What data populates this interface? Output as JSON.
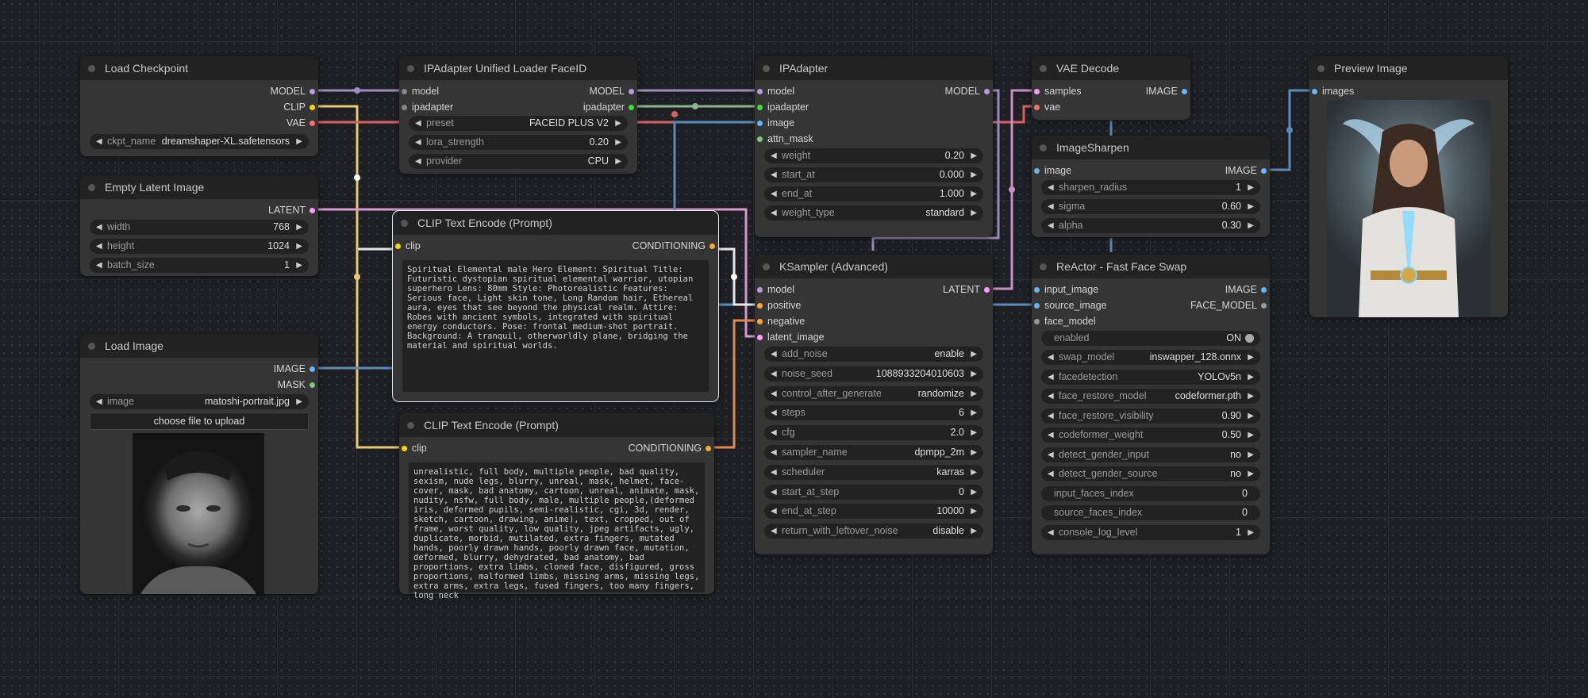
{
  "nodes": {
    "load_checkpoint": {
      "title": "Load Checkpoint",
      "out": [
        "MODEL",
        "CLIP",
        "VAE"
      ],
      "ckpt_label": "ckpt_name",
      "ckpt_value": "dreamshaper-XL.safetensors"
    },
    "empty_latent": {
      "title": "Empty Latent Image",
      "out": "LATENT",
      "width_label": "width",
      "width": "768",
      "height_label": "height",
      "height": "1024",
      "batch_label": "batch_size",
      "batch": "1"
    },
    "load_image": {
      "title": "Load Image",
      "out": [
        "IMAGE",
        "MASK"
      ],
      "image_label": "image",
      "image_value": "matoshi-portrait.jpg",
      "upload": "choose file to upload"
    },
    "ipa_loader": {
      "title": "IPAdapter Unified Loader FaceID",
      "in": [
        "model",
        "ipadapter"
      ],
      "out": [
        "MODEL",
        "ipadapter"
      ],
      "preset_label": "preset",
      "preset": "FACEID PLUS V2",
      "lora_label": "lora_strength",
      "lora": "0.20",
      "provider_label": "provider",
      "provider": "CPU"
    },
    "clip_pos": {
      "title": "CLIP Text Encode (Prompt)",
      "in": "clip",
      "out": "CONDITIONING",
      "text": "Spiritual Elemental male Hero Element: Spiritual Title: Futuristic dystopian spiritual elemental warrior, utopian superhero Lens: 80mm Style: Photorealistic Features: Serious face, Light skin tone, Long Random hair, Ethereal aura, eyes that see beyond the physical realm. Attire: Robes with ancient symbols, integrated with spiritual energy conductors. Pose: frontal medium-shot portrait. Background: A tranquil, otherworldly plane, bridging the material and spiritual worlds."
    },
    "clip_neg": {
      "title": "CLIP Text Encode (Prompt)",
      "in": "clip",
      "out": "CONDITIONING",
      "text": "unrealistic, full body, multiple people, bad quality, sexism, nude legs, blurry, unreal, mask, helmet, face-cover, mask, bad anatomy, cartoon, unreal, animate, mask, nudity, nsfw, full body, male, multiple people,(deformed iris, deformed pupils, semi-realistic, cgi, 3d, render, sketch, cartoon, drawing, anime), text, cropped, out of frame, worst quality, low quality, jpeg artifacts, ugly, duplicate, morbid, mutilated, extra fingers, mutated hands, poorly drawn hands, poorly drawn face, mutation, deformed, blurry, dehydrated, bad anatomy, bad proportions, extra limbs, cloned face, disfigured, gross proportions, malformed limbs, missing arms, missing legs, extra arms, extra legs, fused fingers, too many fingers, long neck"
    },
    "ipadapter": {
      "title": "IPAdapter",
      "in": [
        "model",
        "ipadapter",
        "image",
        "attn_mask"
      ],
      "out": "MODEL",
      "widgets": [
        {
          "k": "weight",
          "v": "0.20"
        },
        {
          "k": "start_at",
          "v": "0.000"
        },
        {
          "k": "end_at",
          "v": "1.000"
        },
        {
          "k": "weight_type",
          "v": "standard"
        }
      ]
    },
    "ksampler": {
      "title": "KSampler (Advanced)",
      "in": [
        "model",
        "positive",
        "negative",
        "latent_image"
      ],
      "out": "LATENT",
      "widgets": [
        {
          "k": "add_noise",
          "v": "enable"
        },
        {
          "k": "noise_seed",
          "v": "1088933204010603"
        },
        {
          "k": "control_after_generate",
          "v": "randomize"
        },
        {
          "k": "steps",
          "v": "6"
        },
        {
          "k": "cfg",
          "v": "2.0"
        },
        {
          "k": "sampler_name",
          "v": "dpmpp_2m"
        },
        {
          "k": "scheduler",
          "v": "karras"
        },
        {
          "k": "start_at_step",
          "v": "0"
        },
        {
          "k": "end_at_step",
          "v": "10000"
        },
        {
          "k": "return_with_leftover_noise",
          "v": "disable"
        }
      ]
    },
    "vae_decode": {
      "title": "VAE Decode",
      "in": [
        "samples",
        "vae"
      ],
      "out": "IMAGE"
    },
    "sharpen": {
      "title": "ImageSharpen",
      "in": "image",
      "out": "IMAGE",
      "widgets": [
        {
          "k": "sharpen_radius",
          "v": "1"
        },
        {
          "k": "sigma",
          "v": "0.60"
        },
        {
          "k": "alpha",
          "v": "0.30"
        }
      ]
    },
    "reactor": {
      "title": "ReActor - Fast Face Swap",
      "in": [
        "input_image",
        "source_image",
        "face_model"
      ],
      "out": [
        "IMAGE",
        "FACE_MODEL"
      ],
      "enabled_label": "enabled",
      "enabled_value": "ON",
      "widgets": [
        {
          "k": "swap_model",
          "v": "inswapper_128.onnx"
        },
        {
          "k": "facedetection",
          "v": "YOLOv5n"
        },
        {
          "k": "face_restore_model",
          "v": "codeformer.pth"
        },
        {
          "k": "face_restore_visibility",
          "v": "0.90"
        },
        {
          "k": "codeformer_weight",
          "v": "0.50"
        },
        {
          "k": "detect_gender_input",
          "v": "no"
        },
        {
          "k": "detect_gender_source",
          "v": "no"
        },
        {
          "k": "input_faces_index",
          "v": "0"
        },
        {
          "k": "source_faces_index",
          "v": "0"
        },
        {
          "k": "console_log_level",
          "v": "1"
        }
      ]
    },
    "preview": {
      "title": "Preview Image",
      "in": "images"
    }
  },
  "colors": {
    "model": "#b39ddb",
    "clip": "#ffd500",
    "vae": "#ff6e6e",
    "latent": "#ff9cf9",
    "conditioning": "#ffa931",
    "image": "#64b5f6",
    "ipadapter": "#3cdc3c",
    "mask": "#81c784"
  }
}
